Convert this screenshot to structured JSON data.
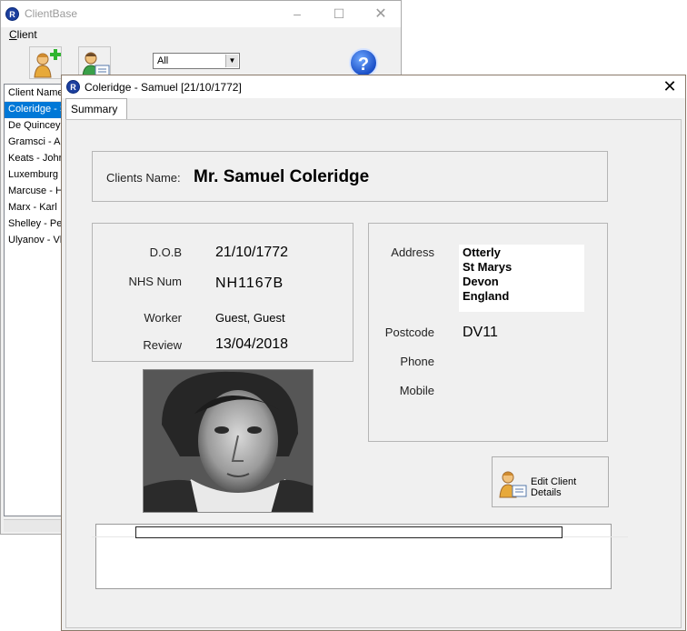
{
  "back_window": {
    "title": "ClientBase",
    "menu": {
      "client_label_first": "C",
      "client_label_rest": "lient"
    },
    "filter": {
      "selected": "All"
    },
    "help_label": "?",
    "list": {
      "header": "Client Name",
      "rows": [
        "Coleridge - Samuel",
        "De Quincey - Thomas",
        "Gramsci - Antonio",
        "Keats - John",
        "Luxemburg - Rosa",
        "Marcuse - Herbert",
        "Marx - Karl",
        "Shelley - Percy",
        "Ulyanov - Vladimir"
      ]
    }
  },
  "front_window": {
    "title": "Coleridge - Samuel [21/10/1772]",
    "tab": "Summary",
    "clients_name_label": "Clients Name:",
    "clients_name": "Mr. Samuel Coleridge",
    "dob_label": "D.O.B",
    "dob": "21/10/1772",
    "nhs_label": "NHS Num",
    "nhs": "NH1167B",
    "worker_label": "Worker",
    "worker": "Guest, Guest",
    "review_label": "Review",
    "review": "13/04/2018",
    "address_label": "Address",
    "address_lines": [
      "Otterly",
      "St Marys",
      "Devon",
      "England"
    ],
    "postcode_label": "Postcode",
    "postcode": "DV11",
    "phone_label": "Phone",
    "mobile_label": "Mobile",
    "edit_button": "Edit Client Details"
  },
  "colors": {
    "selection": "#0078d7",
    "window_bg": "#f0f0f0",
    "accent_icon": "#1c3f9e"
  }
}
